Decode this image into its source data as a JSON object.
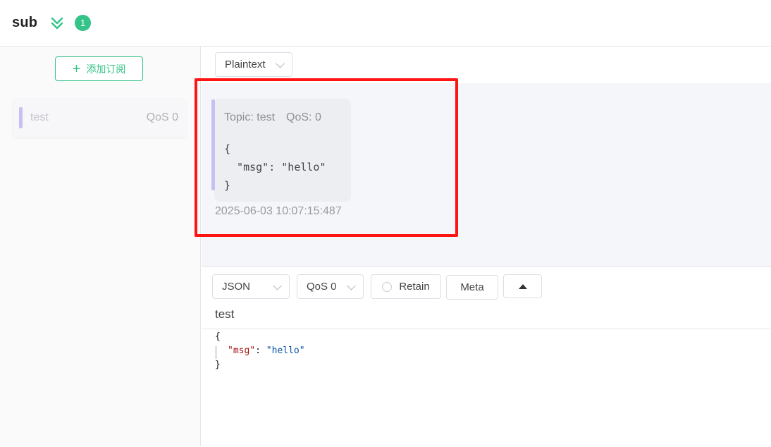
{
  "header": {
    "connection_name": "sub",
    "subscription_count": "1"
  },
  "sidebar": {
    "add_subscription_label": "添加订阅",
    "subscriptions": [
      {
        "topic": "test",
        "qos": "QoS 0",
        "color": "#c9bff2"
      }
    ]
  },
  "message_view": {
    "format_select": "Plaintext",
    "messages": [
      {
        "topic_label": "Topic: test",
        "qos_label": "QoS: 0",
        "payload_line1": "{",
        "payload_line2": "  \"msg\": \"hello\"",
        "payload_line3": "}",
        "time": "2025-06-03 10:07:15:487"
      }
    ]
  },
  "publish": {
    "payload_format": "JSON",
    "qos": "QoS 0",
    "retain_label": "Retain",
    "meta_label": "Meta",
    "topic": "test",
    "editor": {
      "open_brace": "{",
      "key": "\"msg\"",
      "colon": ": ",
      "value": "\"hello\"",
      "close_brace": "}"
    }
  },
  "colors": {
    "accent": "#34c388",
    "subscription_bar": "#c9bff2",
    "highlight": "#ff1414"
  }
}
